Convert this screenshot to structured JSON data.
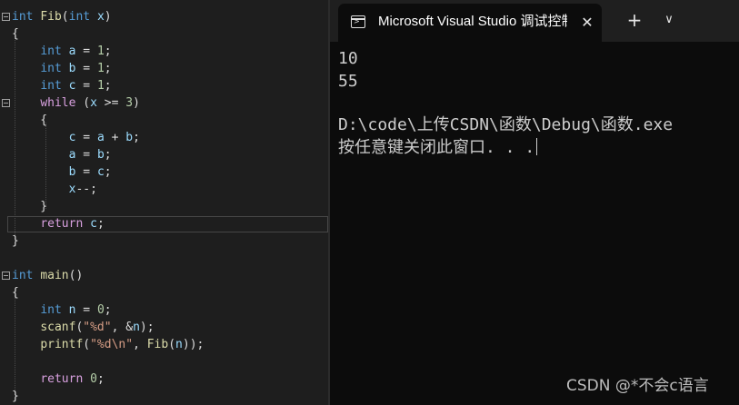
{
  "editor": {
    "lines": [
      {
        "tokens": [
          {
            "t": "int",
            "c": "kw"
          },
          {
            "t": " "
          },
          {
            "t": "Fib",
            "c": "fn"
          },
          {
            "t": "("
          },
          {
            "t": "int",
            "c": "kw"
          },
          {
            "t": " "
          },
          {
            "t": "x",
            "c": "var"
          },
          {
            "t": ")"
          }
        ]
      },
      {
        "tokens": [
          {
            "t": "{"
          }
        ]
      },
      {
        "tokens": [
          {
            "t": "    "
          },
          {
            "t": "int",
            "c": "kw"
          },
          {
            "t": " "
          },
          {
            "t": "a",
            "c": "var"
          },
          {
            "t": " = "
          },
          {
            "t": "1",
            "c": "num"
          },
          {
            "t": ";"
          }
        ]
      },
      {
        "tokens": [
          {
            "t": "    "
          },
          {
            "t": "int",
            "c": "kw"
          },
          {
            "t": " "
          },
          {
            "t": "b",
            "c": "var"
          },
          {
            "t": " = "
          },
          {
            "t": "1",
            "c": "num"
          },
          {
            "t": ";"
          }
        ]
      },
      {
        "tokens": [
          {
            "t": "    "
          },
          {
            "t": "int",
            "c": "kw"
          },
          {
            "t": " "
          },
          {
            "t": "c",
            "c": "var"
          },
          {
            "t": " = "
          },
          {
            "t": "1",
            "c": "num"
          },
          {
            "t": ";"
          }
        ]
      },
      {
        "tokens": [
          {
            "t": "    "
          },
          {
            "t": "while",
            "c": "ctl"
          },
          {
            "t": " ("
          },
          {
            "t": "x",
            "c": "var"
          },
          {
            "t": " >= "
          },
          {
            "t": "3",
            "c": "num"
          },
          {
            "t": ")"
          }
        ]
      },
      {
        "tokens": [
          {
            "t": "    {"
          }
        ]
      },
      {
        "tokens": [
          {
            "t": "        "
          },
          {
            "t": "c",
            "c": "var"
          },
          {
            "t": " = "
          },
          {
            "t": "a",
            "c": "var"
          },
          {
            "t": " + "
          },
          {
            "t": "b",
            "c": "var"
          },
          {
            "t": ";"
          }
        ]
      },
      {
        "tokens": [
          {
            "t": "        "
          },
          {
            "t": "a",
            "c": "var"
          },
          {
            "t": " = "
          },
          {
            "t": "b",
            "c": "var"
          },
          {
            "t": ";"
          }
        ]
      },
      {
        "tokens": [
          {
            "t": "        "
          },
          {
            "t": "b",
            "c": "var"
          },
          {
            "t": " = "
          },
          {
            "t": "c",
            "c": "var"
          },
          {
            "t": ";"
          }
        ]
      },
      {
        "tokens": [
          {
            "t": "        "
          },
          {
            "t": "x",
            "c": "var"
          },
          {
            "t": "--;"
          }
        ]
      },
      {
        "tokens": [
          {
            "t": "    }"
          }
        ]
      },
      {
        "tokens": [
          {
            "t": "    "
          },
          {
            "t": "return",
            "c": "ctl"
          },
          {
            "t": " "
          },
          {
            "t": "c",
            "c": "var"
          },
          {
            "t": ";"
          }
        ]
      },
      {
        "tokens": [
          {
            "t": "}"
          }
        ]
      },
      {
        "tokens": []
      },
      {
        "tokens": [
          {
            "t": "int",
            "c": "kw"
          },
          {
            "t": " "
          },
          {
            "t": "main",
            "c": "fn"
          },
          {
            "t": "()"
          }
        ]
      },
      {
        "tokens": [
          {
            "t": "{"
          }
        ]
      },
      {
        "tokens": [
          {
            "t": "    "
          },
          {
            "t": "int",
            "c": "kw"
          },
          {
            "t": " "
          },
          {
            "t": "n",
            "c": "var"
          },
          {
            "t": " = "
          },
          {
            "t": "0",
            "c": "num"
          },
          {
            "t": ";"
          }
        ]
      },
      {
        "tokens": [
          {
            "t": "    "
          },
          {
            "t": "scanf",
            "c": "fn"
          },
          {
            "t": "("
          },
          {
            "t": "\"%d\"",
            "c": "str"
          },
          {
            "t": ", &"
          },
          {
            "t": "n",
            "c": "var"
          },
          {
            "t": ");"
          }
        ]
      },
      {
        "tokens": [
          {
            "t": "    "
          },
          {
            "t": "printf",
            "c": "fn"
          },
          {
            "t": "("
          },
          {
            "t": "\"%d\\n\"",
            "c": "str"
          },
          {
            "t": ", "
          },
          {
            "t": "Fib",
            "c": "fn"
          },
          {
            "t": "("
          },
          {
            "t": "n",
            "c": "var"
          },
          {
            "t": "));"
          }
        ]
      },
      {
        "tokens": []
      },
      {
        "tokens": [
          {
            "t": "    "
          },
          {
            "t": "return",
            "c": "ctl"
          },
          {
            "t": " "
          },
          {
            "t": "0",
            "c": "num"
          },
          {
            "t": ";"
          }
        ]
      },
      {
        "tokens": [
          {
            "t": "}"
          }
        ]
      }
    ]
  },
  "terminal": {
    "tab_title": "Microsoft Visual Studio 调试控制台",
    "close_glyph": "✕",
    "new_tab_glyph": "+",
    "dropdown_glyph": "∨",
    "output": [
      "10",
      "55",
      "",
      "D:\\code\\上传CSDN\\函数\\Debug\\函数.exe",
      "按任意键关闭此窗口. . ."
    ]
  },
  "watermark": "CSDN @*不会c语言",
  "colors": {
    "keyword": "#569cd6",
    "control": "#d8a0df",
    "function": "#dcdcaa",
    "number": "#b5cea8",
    "string": "#d69d85",
    "variable": "#9cdcfe",
    "terminal_bg": "#0c0c0c",
    "editor_bg": "#1e1e1e"
  },
  "icons": {
    "fold_fib": "collapse-box-icon",
    "fold_main": "collapse-box-icon",
    "terminal": "console-window-icon",
    "close": "close-icon",
    "new_tab": "plus-icon",
    "dropdown": "chevron-down-icon"
  }
}
